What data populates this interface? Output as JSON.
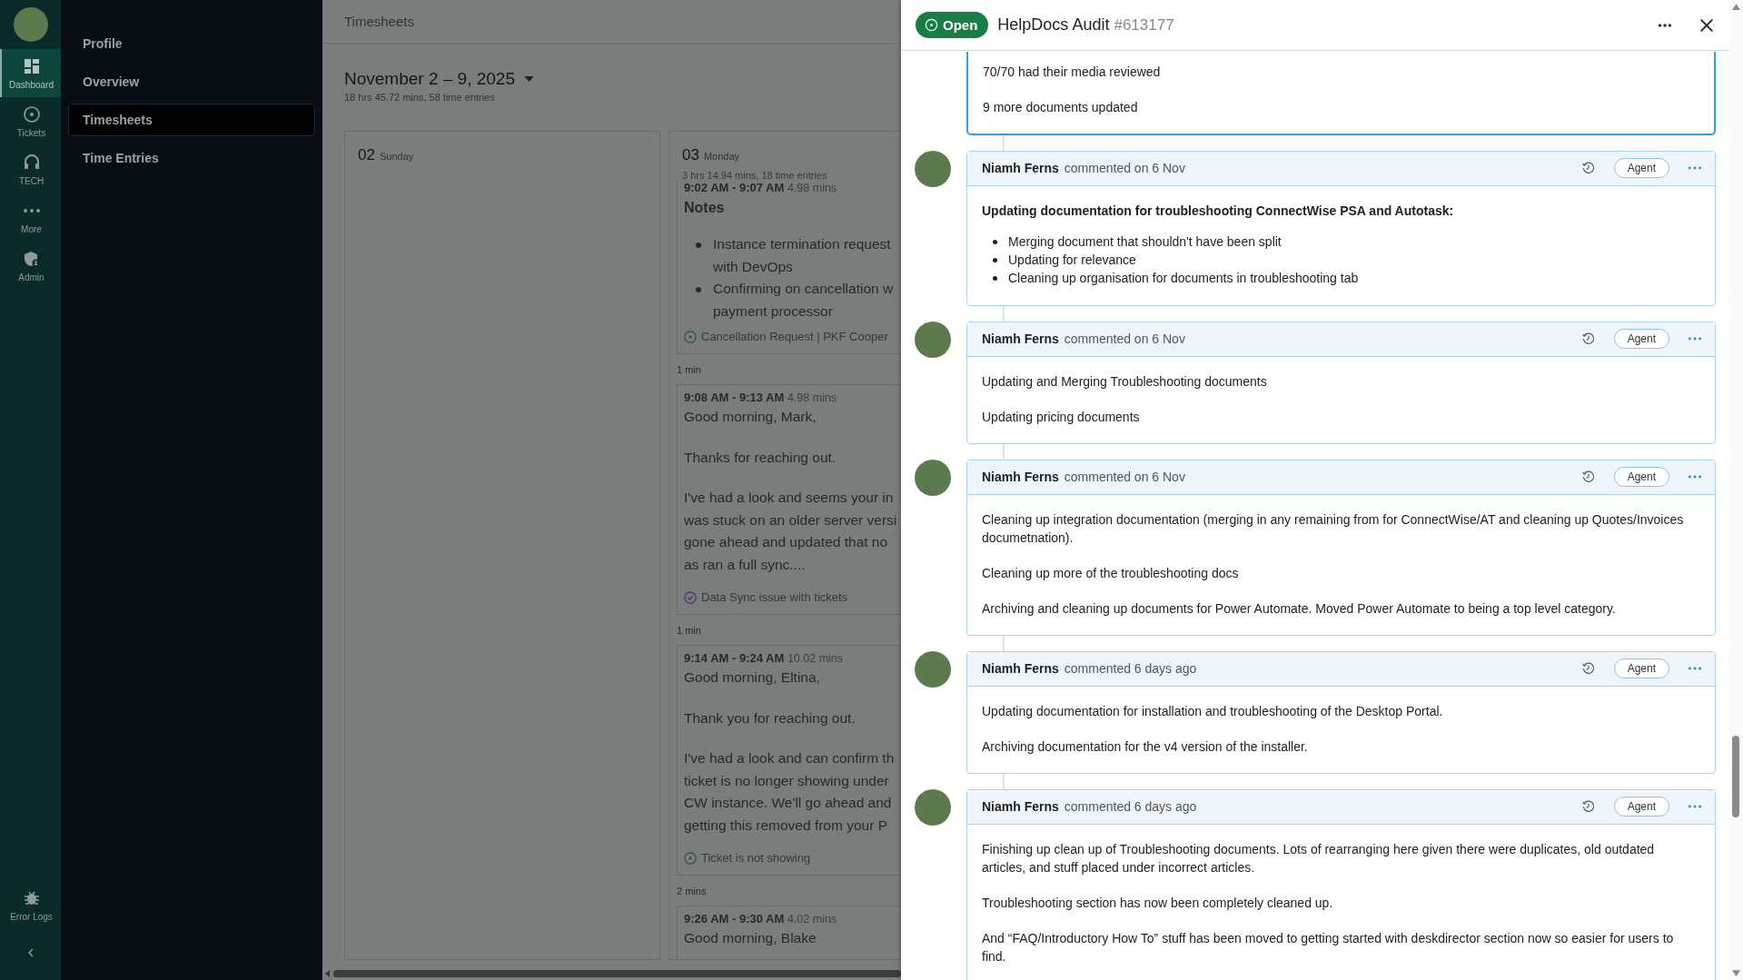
{
  "rail": {
    "items": [
      {
        "label": "Dashboard",
        "selected": true
      },
      {
        "label": "Tickets",
        "selected": false
      },
      {
        "label": "TECH",
        "selected": false
      },
      {
        "label": "More",
        "selected": false
      },
      {
        "label": "Admin",
        "selected": false
      }
    ],
    "footer": [
      {
        "label": "Error Logs",
        "selected": false
      }
    ]
  },
  "nav": {
    "items": [
      {
        "label": "Profile",
        "selected": false
      },
      {
        "label": "Overview",
        "selected": false
      },
      {
        "label": "Timesheets",
        "selected": true
      },
      {
        "label": "Time Entries",
        "selected": false
      }
    ]
  },
  "main": {
    "breadcrumb": "Timesheets",
    "range": "November 2 – 9, 2025",
    "summary": "18 hrs 45.72 mins, 58 time entries",
    "days": [
      {
        "num": "02",
        "name": "Sunday"
      },
      {
        "num": "03",
        "name": "Monday",
        "summary": "3 hrs 14.94 mins, 18 time entries",
        "items": [
          {
            "kind": "entry",
            "time": "9:02 AM - 9:07 AM",
            "duration": "4.98 mins",
            "heading": "Notes",
            "bullets": [
              "Instance termination request\nwith DevOps",
              "Confirming on cancellation w\npayment processor"
            ],
            "ticket": {
              "title": "Cancellation Request | PKF Cooper",
              "resolved": false
            }
          },
          {
            "kind": "gap",
            "label": "1 min"
          },
          {
            "kind": "entry",
            "time": "9:08 AM - 9:13 AM",
            "duration": "4.98 mins",
            "paragraphs": [
              "Good morning, Mark,",
              "Thanks for reaching out.",
              "I've had a look and seems your in\nwas stuck on an older server versi\ngone ahead and updated that no\nas ran a full sync...."
            ],
            "ticket": {
              "title": "Data Sync issue with tickets",
              "resolved": true
            }
          },
          {
            "kind": "gap",
            "label": "1 min"
          },
          {
            "kind": "entry",
            "time": "9:14 AM - 9:24 AM",
            "duration": "10.02 mins",
            "paragraphs": [
              "Good morning, Eltina,",
              "Thank you for reaching out.",
              "I've had a look and can confirm th\nticket is no longer showing under\nCW instance. We'll go ahead and\ngetting this removed from your P"
            ],
            "ticket": {
              "title": "Ticket is not showing",
              "resolved": false
            }
          },
          {
            "kind": "gap",
            "label": "2 mins"
          },
          {
            "kind": "entry",
            "time": "9:26 AM - 9:30 AM",
            "duration": "4.02 mins",
            "paragraphs": [
              "Good morning, Blake"
            ]
          }
        ]
      }
    ]
  },
  "panel": {
    "status": "Open",
    "title": "HelpDocs Audit",
    "number": "#613177",
    "comments": [
      {
        "highlighted": true,
        "blocks": [
          {
            "kind": "p",
            "text": "70/70 had their media reviewed"
          },
          {
            "kind": "p",
            "text": "9 more documents updated"
          }
        ]
      },
      {
        "highlighted": false,
        "author": "Niamh Ferns",
        "meta": "commented on 6 Nov",
        "badge": "Agent",
        "blocks": [
          {
            "kind": "strong",
            "text": "Updating documentation for troubleshooting ConnectWise PSA and Autotask:"
          },
          {
            "kind": "list",
            "items": [
              "Merging document that shouldn't have been split",
              "Updating for relevance",
              "Cleaning up organisation for documents in troubleshooting tab"
            ]
          }
        ]
      },
      {
        "highlighted": false,
        "author": "Niamh Ferns",
        "meta": "commented on 6 Nov",
        "badge": "Agent",
        "blocks": [
          {
            "kind": "p",
            "text": "Updating and Merging Troubleshooting documents"
          },
          {
            "kind": "p",
            "text": "Updating pricing documents"
          }
        ]
      },
      {
        "highlighted": false,
        "author": "Niamh Ferns",
        "meta": "commented on 6 Nov",
        "badge": "Agent",
        "blocks": [
          {
            "kind": "p",
            "text": "Cleaning up integration documentation (merging in any remaining from for ConnectWise/AT and cleaning up Quotes/Invoices documetnation)."
          },
          {
            "kind": "p",
            "text": "Cleaning up more of the troubleshooting docs"
          },
          {
            "kind": "p",
            "text": "Archiving and cleaning up documents for Power Automate. Moved Power Automate to being a top level category."
          }
        ]
      },
      {
        "highlighted": false,
        "author": "Niamh Ferns",
        "meta": "commented 6 days ago",
        "badge": "Agent",
        "blocks": [
          {
            "kind": "p",
            "text": "Updating documentation for installation and troubleshooting of the Desktop Portal."
          },
          {
            "kind": "p",
            "text": "Archiving documentation for the v4 version of the installer."
          }
        ]
      },
      {
        "highlighted": false,
        "author": "Niamh Ferns",
        "meta": "commented 6 days ago",
        "badge": "Agent",
        "blocks": [
          {
            "kind": "p",
            "text": "Finishing up clean up of Troubleshooting documents. Lots of rearranging here given there were duplicates, old outdated articles, and stuff placed under incorrect articles."
          },
          {
            "kind": "p",
            "text": "Troubleshooting section has now been completely cleaned up."
          },
          {
            "kind": "p",
            "text": "And “FAQ/Introductory How To” stuff has been moved to getting started with deskdirector section now so easier for users to find."
          }
        ]
      }
    ]
  }
}
